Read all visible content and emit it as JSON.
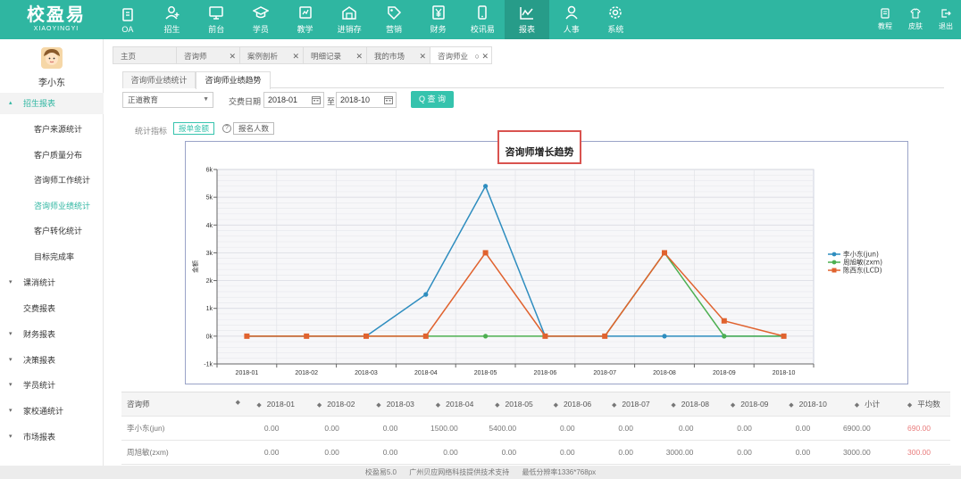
{
  "app": {
    "logo_cn": "校盈易",
    "logo_en": "XIAOYINGYI"
  },
  "nav": [
    {
      "label": "OA",
      "icon": "book-icon"
    },
    {
      "label": "招生",
      "icon": "user-add-icon"
    },
    {
      "label": "前台",
      "icon": "monitor-icon"
    },
    {
      "label": "学员",
      "icon": "graduation-cap-icon"
    },
    {
      "label": "教学",
      "icon": "teach-icon"
    },
    {
      "label": "进销存",
      "icon": "warehouse-icon"
    },
    {
      "label": "营销",
      "icon": "tag-icon"
    },
    {
      "label": "财务",
      "icon": "yen-icon"
    },
    {
      "label": "校讯易",
      "icon": "mobile-icon"
    },
    {
      "label": "报表",
      "icon": "line-chart-icon"
    },
    {
      "label": "人事",
      "icon": "person-icon"
    },
    {
      "label": "系统",
      "icon": "gear-icon"
    }
  ],
  "topright": [
    {
      "label": "教程",
      "icon": "tutorial-icon"
    },
    {
      "label": "皮肤",
      "icon": "shirt-icon"
    },
    {
      "label": "退出",
      "icon": "logout-icon"
    }
  ],
  "user": {
    "name": "李小东"
  },
  "sidebar": {
    "group_open": "招生报表",
    "sub_items": [
      "客户来源统计",
      "客户质量分布",
      "咨询师工作统计",
      "咨询师业绩统计",
      "客户转化统计",
      "目标完成率"
    ],
    "groups": [
      "课消统计",
      "交费报表",
      "财务报表",
      "决策报表",
      "学员统计",
      "家校通统计",
      "市场报表"
    ]
  },
  "tabs": [
    "主页",
    "咨询师",
    "案例剖析",
    "明细记录",
    "我的市场",
    "咨询师业"
  ],
  "subtabs": [
    "咨询师业绩统计",
    "咨询师业绩趋势"
  ],
  "filter": {
    "select_value": "正道教育",
    "date_label": "交费日期",
    "date_from": "2018-01",
    "to_label": "至",
    "date_to": "2018-10",
    "query_label": "Q 查 询"
  },
  "stat": {
    "label": "统计指标",
    "btn_amount": "报单金额",
    "btn_count": "报名人数",
    "help": "?"
  },
  "chart_title": "咨询师增长趋势",
  "chart_data": {
    "type": "line",
    "categories": [
      "2018-01",
      "2018-02",
      "2018-03",
      "2018-04",
      "2018-05",
      "2018-06",
      "2018-07",
      "2018-08",
      "2018-09",
      "2018-10"
    ],
    "series": [
      {
        "name": "李小东(jun)",
        "color": "#2e8dbf",
        "marker": "circle",
        "values": [
          0,
          0,
          0,
          1500,
          5400,
          0,
          0,
          0,
          0,
          0
        ]
      },
      {
        "name": "周旭敏(zxm)",
        "color": "#4caf50",
        "marker": "circle",
        "values": [
          0,
          0,
          0,
          0,
          0,
          0,
          0,
          3000,
          0,
          0
        ]
      },
      {
        "name": "陈西东(LCD)",
        "color": "#e0622e",
        "marker": "square",
        "values": [
          0,
          0,
          0,
          0,
          3000,
          0,
          0,
          3000,
          550,
          0
        ]
      }
    ],
    "ylabel": "金额",
    "ylim": [
      -1000,
      6000
    ],
    "yticks": [
      "-1k",
      "0k",
      "1k",
      "2k",
      "3k",
      "4k",
      "5k",
      "6k"
    ],
    "legend": "right"
  },
  "table": {
    "columns": [
      "咨询师",
      "2018-01",
      "2018-02",
      "2018-03",
      "2018-04",
      "2018-05",
      "2018-06",
      "2018-07",
      "2018-08",
      "2018-09",
      "2018-10",
      "小计",
      "平均数"
    ],
    "rows": [
      [
        "李小东(jun)",
        "0.00",
        "0.00",
        "0.00",
        "1500.00",
        "5400.00",
        "0.00",
        "0.00",
        "0.00",
        "0.00",
        "0.00",
        "6900.00",
        "690.00"
      ],
      [
        "周旭敏(zxm)",
        "0.00",
        "0.00",
        "0.00",
        "0.00",
        "0.00",
        "0.00",
        "0.00",
        "3000.00",
        "0.00",
        "0.00",
        "3000.00",
        "300.00"
      ]
    ]
  },
  "footer": [
    "校盈易5.0",
    "广州贝应网络科技提供技术支持",
    "最低分辨率1336*768px"
  ]
}
